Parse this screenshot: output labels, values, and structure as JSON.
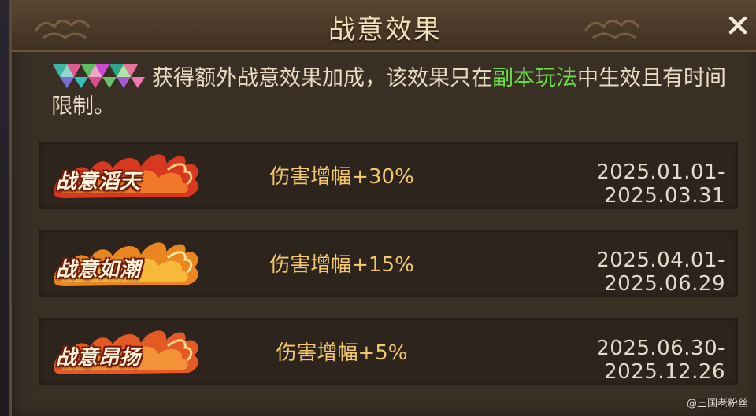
{
  "dialog": {
    "title": "战意效果",
    "close_label": "×"
  },
  "description": {
    "text_before_link": "获得额外战意效果加成，该效果只在",
    "link_text": "副本玩法",
    "text_after_link": "中生效且有时间限制。"
  },
  "effects": [
    {
      "badge": "战意滔天",
      "effect": "伤害增幅+30%",
      "period": "2025.01.01-2025.03.31",
      "flame_color": "#d8381f"
    },
    {
      "badge": "战意如潮",
      "effect": "伤害增幅+15%",
      "period": "2025.04.01-2025.06.29",
      "flame_color": "#e9861f"
    },
    {
      "badge": "战意昂扬",
      "effect": "伤害增幅+5%",
      "period": "2025.06.30-2025.12.26",
      "flame_color": "#e45a25"
    }
  ],
  "watermark": "@三国老粉丝",
  "colors": {
    "link": "#6bdc4a",
    "effect_text": "#f3c86a",
    "title_text": "#f2dfb7"
  },
  "icons": {
    "close": "close-icon",
    "avatar": "pixelated-avatar-icon",
    "flame": "flame-badge-icon"
  }
}
